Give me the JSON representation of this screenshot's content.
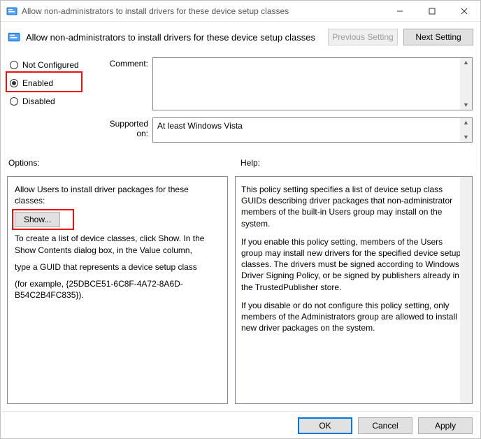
{
  "window": {
    "title": "Allow non-administrators to install drivers for these device setup classes"
  },
  "header": {
    "title": "Allow non-administrators to install drivers for these device setup classes",
    "prev": "Previous Setting",
    "next": "Next Setting"
  },
  "states": {
    "not_configured": "Not Configured",
    "enabled": "Enabled",
    "disabled": "Disabled",
    "selected": "enabled"
  },
  "comment": {
    "label": "Comment:",
    "value": ""
  },
  "supported": {
    "label": "Supported on:",
    "value": "At least Windows Vista"
  },
  "labels": {
    "options": "Options:",
    "help": "Help:"
  },
  "options": {
    "line1": "Allow Users to install driver packages for these classes:",
    "show": "Show...",
    "line2": "To create a list of device classes, click Show. In the Show Contents dialog box, in the Value column,",
    "line3": "type a GUID that represents a device setup class",
    "line4": "(for example, {25DBCE51-6C8F-4A72-8A6D-B54C2B4FC835})."
  },
  "help": {
    "p1": "This policy setting specifies a list of device setup class GUIDs describing driver packages that non-administrator members of the built-in Users group may install on the system.",
    "p2": "If you enable this policy setting, members of the Users group may install new drivers for the specified device setup classes. The drivers must be signed according to Windows Driver Signing Policy, or be signed by publishers already in the TrustedPublisher store.",
    "p3": "If you disable or do not configure this policy setting, only members of the Administrators group are allowed to install new driver packages on the system."
  },
  "footer": {
    "ok": "OK",
    "cancel": "Cancel",
    "apply": "Apply"
  }
}
